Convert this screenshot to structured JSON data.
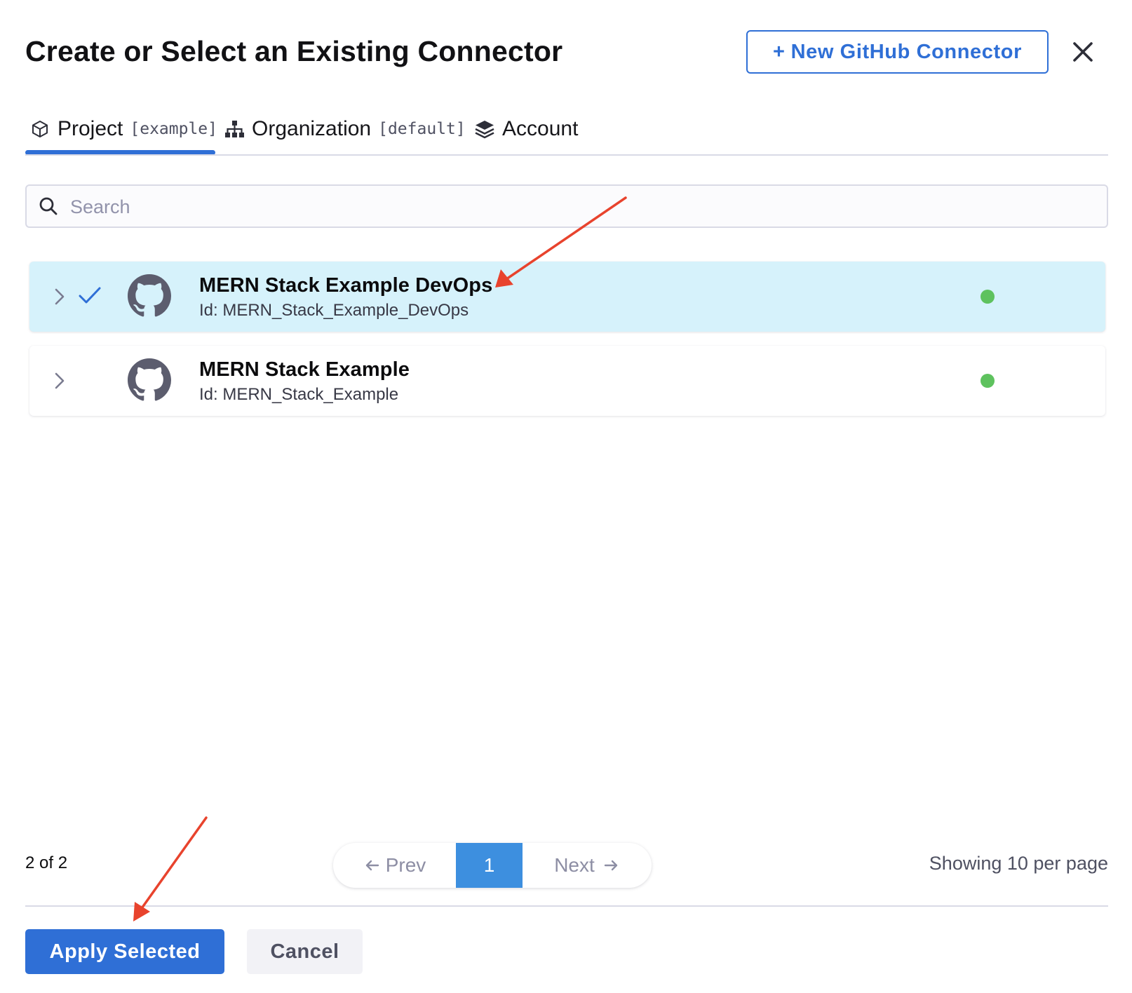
{
  "header": {
    "title": "Create or Select an Existing Connector",
    "new_connector_plus": "+",
    "new_connector_label": "New GitHub Connector",
    "close_icon": "close-icon"
  },
  "tabs": [
    {
      "label": "Project",
      "scope": "[example]",
      "icon": "cube-icon",
      "active": true
    },
    {
      "label": "Organization",
      "scope": "[default]",
      "icon": "org-hierarchy-icon",
      "active": false
    },
    {
      "label": "Account",
      "scope": "",
      "icon": "layers-icon",
      "active": false
    }
  ],
  "search": {
    "placeholder": "Search",
    "value": ""
  },
  "connectors": [
    {
      "name": "MERN Stack Example DevOps",
      "id": "Id: MERN_Stack_Example_DevOps",
      "selected": true,
      "status": "connected"
    },
    {
      "name": "MERN Stack Example",
      "id": "Id: MERN_Stack_Example",
      "selected": false,
      "status": "connected"
    }
  ],
  "pagination": {
    "count_label": "2 of 2",
    "prev_label": "Prev",
    "current_page": "1",
    "next_label": "Next",
    "per_page_label": "Showing 10 per page"
  },
  "footer": {
    "apply_label": "Apply Selected",
    "cancel_label": "Cancel"
  },
  "colors": {
    "accent": "#2f6fd6",
    "selected_row": "#d6f2fb",
    "status_ok": "#5ec25e",
    "annotation_arrow": "#e8432d"
  }
}
